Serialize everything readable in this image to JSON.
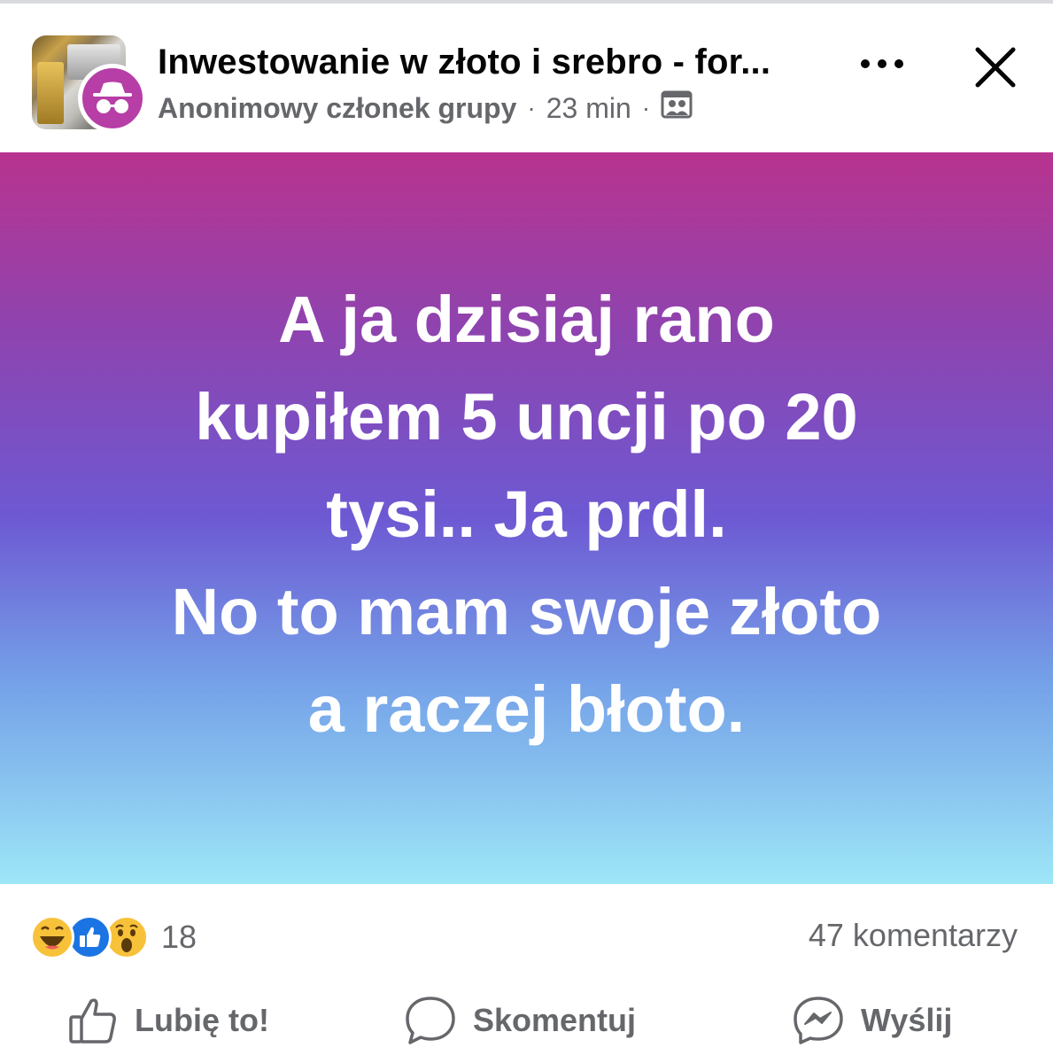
{
  "header": {
    "group_title": "Inwestowanie w złoto i srebro - for...",
    "author": "Anonimowy członek grupy",
    "separator": "·",
    "time": "23 min",
    "more_icon": "more-horizontal-icon",
    "close_icon": "close-icon",
    "privacy_icon": "group-members-icon"
  },
  "post": {
    "lines": [
      "A ja dzisiaj rano",
      "kupiłem 5 uncji po 20",
      "tysi.. Ja prdl.",
      "No to mam swoje złoto",
      "a raczej błoto."
    ],
    "gradient_colors": [
      "#b8338f",
      "#8d44b0",
      "#6d59d3",
      "#74a0e8",
      "#9de6f7"
    ]
  },
  "stats": {
    "reactions": [
      "haha",
      "like",
      "wow"
    ],
    "reaction_count": "18",
    "comments": "47 komentarzy"
  },
  "actions": {
    "like": "Lubię to!",
    "comment": "Skomentuj",
    "send": "Wyślij"
  },
  "colors": {
    "secondary_text": "#65676b",
    "anon_badge": "#b73ea6",
    "like_blue": "#1b74e4"
  }
}
